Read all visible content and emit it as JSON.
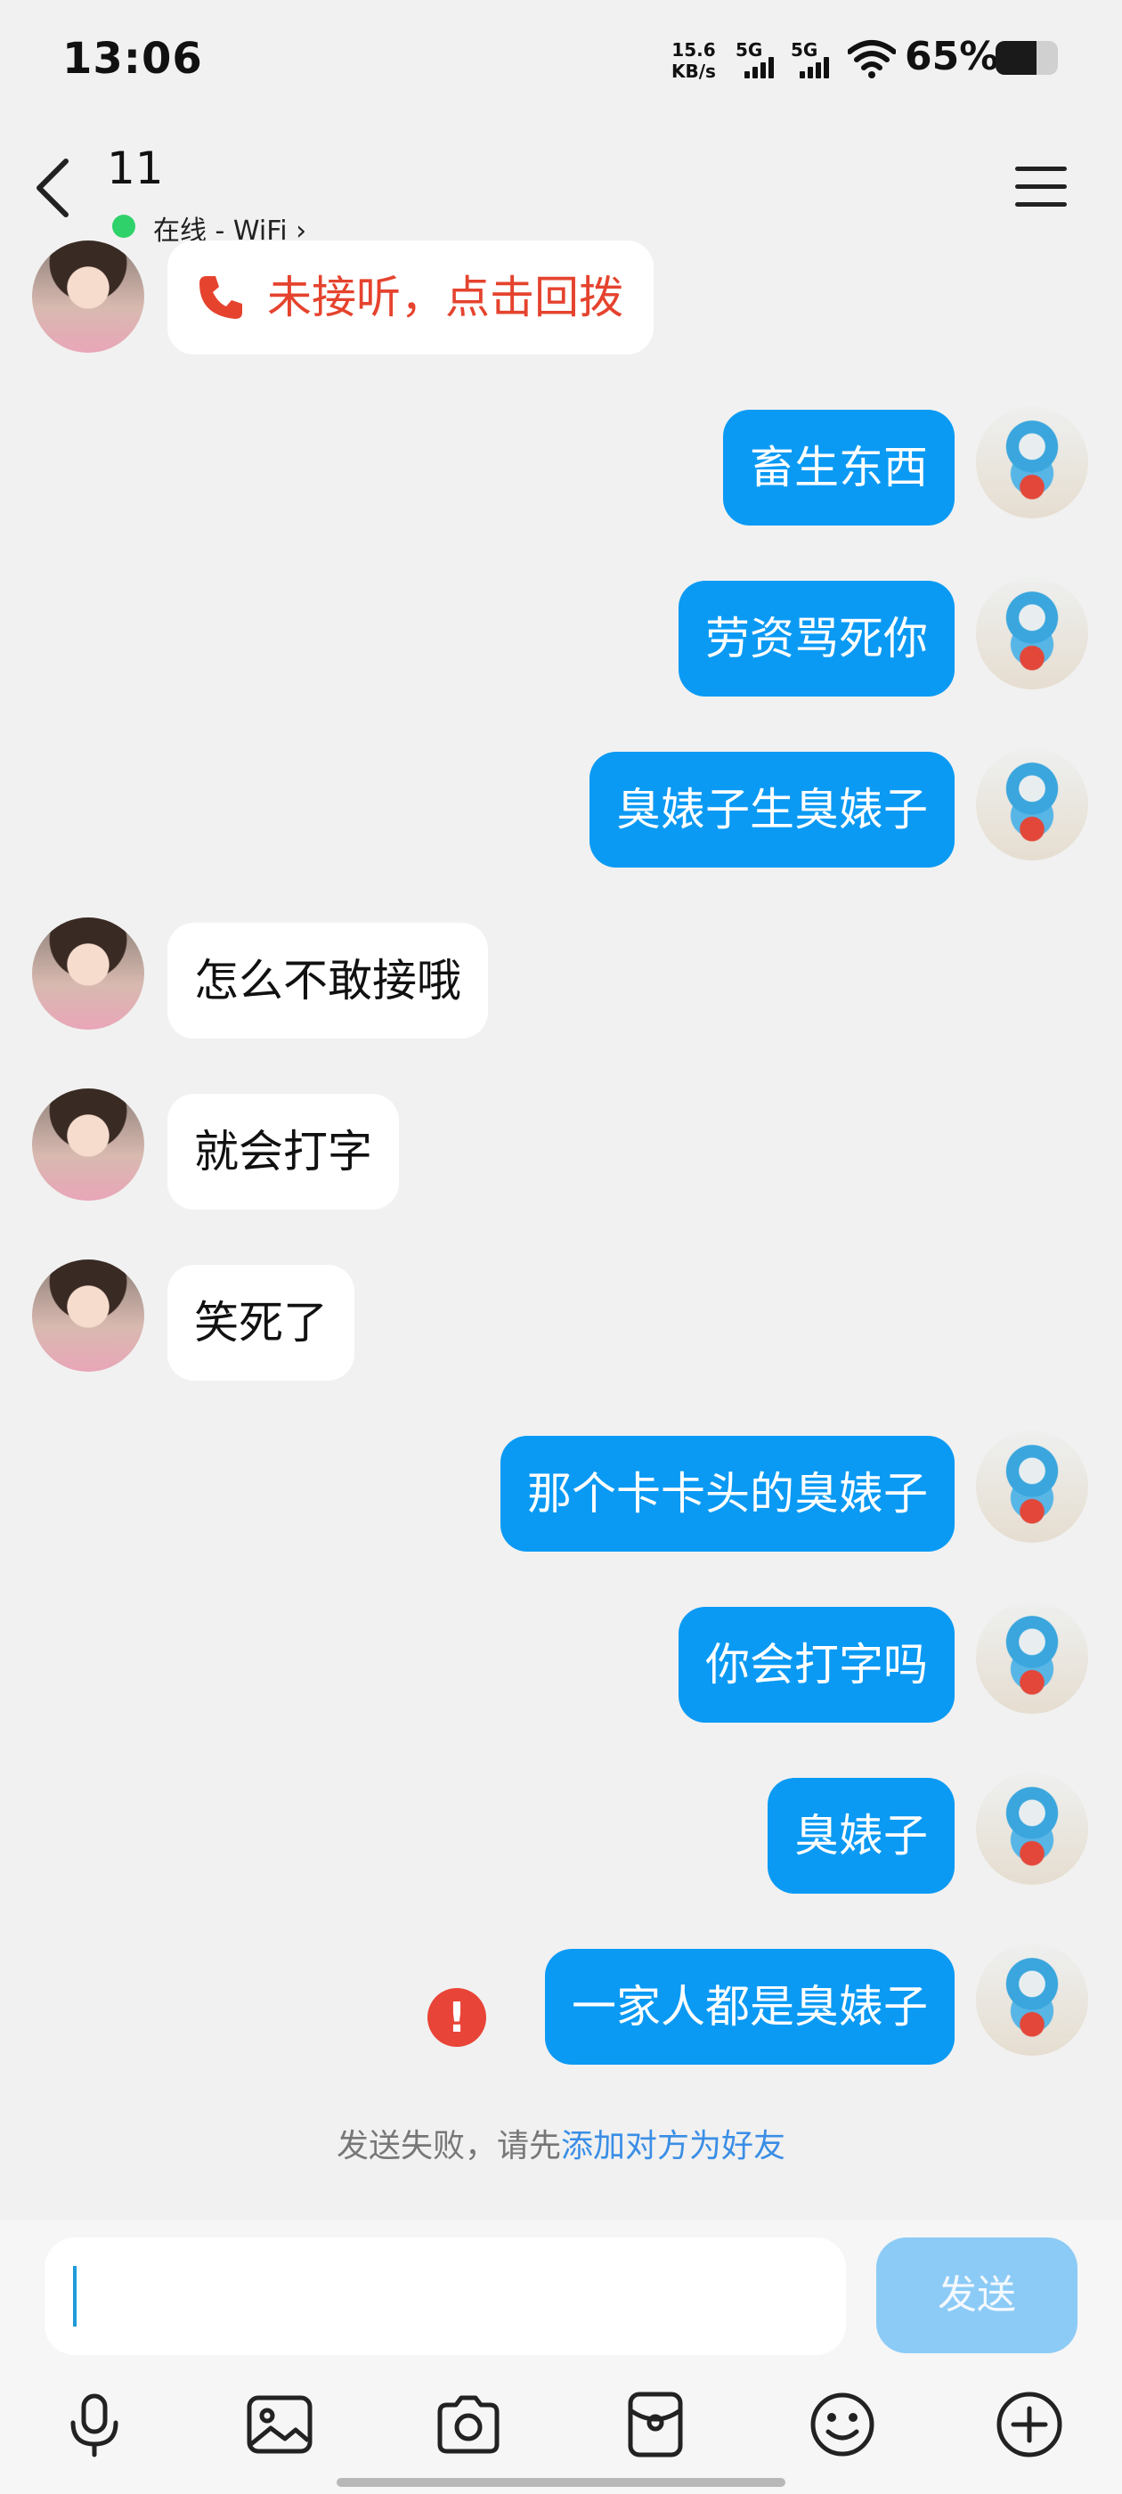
{
  "status_bar": {
    "time": "13:06",
    "net_speed_value": "15.6",
    "net_speed_unit": "KB/s",
    "signal_1_label": "5G",
    "signal_2_label": "5G",
    "battery_percent": "65%",
    "battery_level": 0.65
  },
  "header": {
    "title": "11",
    "online_status": "在线 - WiFi ›",
    "online_color": "#2fd26a"
  },
  "messages": [
    {
      "side": "left",
      "type": "call",
      "text": "未接听，点击回拨",
      "icon": "phone-icon"
    },
    {
      "side": "right",
      "text": "畜生东西"
    },
    {
      "side": "right",
      "text": "劳资骂死你"
    },
    {
      "side": "right",
      "text": "臭婊子生臭婊子"
    },
    {
      "side": "left",
      "text": "怎么不敢接哦"
    },
    {
      "side": "left",
      "text": "就会打字"
    },
    {
      "side": "left",
      "text": "笑死了"
    },
    {
      "side": "right",
      "text": "那个卡卡头的臭婊子"
    },
    {
      "side": "right",
      "text": "你会打字吗"
    },
    {
      "side": "right",
      "text": "臭婊子"
    },
    {
      "side": "right",
      "text": "一家人都是臭婊子",
      "failed": true
    }
  ],
  "fail_icon_glyph": "!",
  "fail_note": {
    "prefix": "发送失败，请先",
    "link": "添加对方为好友"
  },
  "input": {
    "placeholder": "",
    "send_label": "发送"
  },
  "toolbar": [
    "microphone-icon",
    "image-icon",
    "camera-icon",
    "red-packet-icon",
    "emoji-icon",
    "plus-icon"
  ],
  "colors": {
    "outgoing_bubble": "#0a9af4",
    "incoming_bubble": "#ffffff",
    "call_text": "#e5432e",
    "link": "#3a8ee6",
    "send_button": "#8ccbf6"
  }
}
